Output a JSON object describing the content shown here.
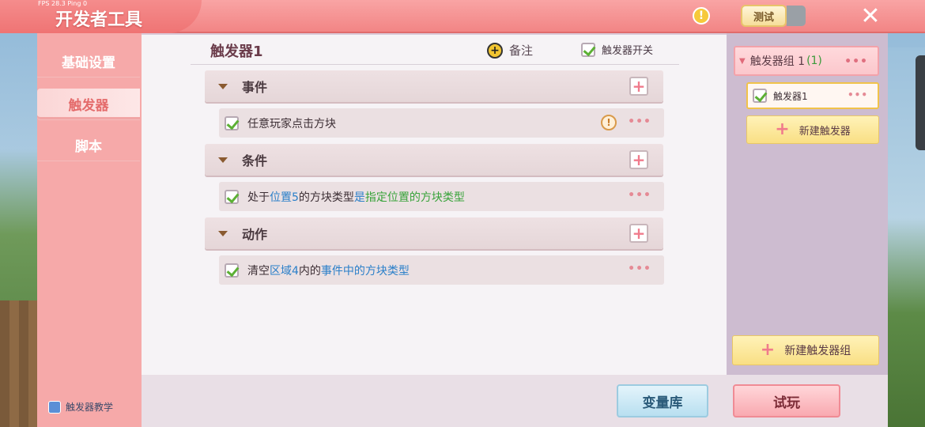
{
  "topbar": {
    "fps": "FPS 28.3  Ping 0",
    "title": "开发者工具",
    "test_label": "测试"
  },
  "sidebar": {
    "items": [
      {
        "label": "基础设置",
        "active": false
      },
      {
        "label": "触发器",
        "active": true
      },
      {
        "label": "脚本",
        "active": false
      }
    ],
    "tutorial_label": "触发器教学"
  },
  "main": {
    "trigger_name": "触发器1",
    "note_label": "备注",
    "switch_label": "触发器开关",
    "sections": [
      {
        "label": "事件",
        "items": [
          {
            "parts": [
              {
                "t": "任意玩家点击方块",
                "c": ""
              }
            ]
          }
        ]
      },
      {
        "label": "条件",
        "items": [
          {
            "parts": [
              {
                "t": "处于",
                "c": ""
              },
              {
                "t": "位置5",
                "c": "blue"
              },
              {
                "t": "的方块类型",
                "c": ""
              },
              {
                "t": "是",
                "c": "blue"
              },
              {
                "t": "指定位置的方块类型",
                "c": "green"
              }
            ]
          }
        ]
      },
      {
        "label": "动作",
        "items": [
          {
            "parts": [
              {
                "t": "清空",
                "c": ""
              },
              {
                "t": "区域4",
                "c": "blue"
              },
              {
                "t": "内的",
                "c": ""
              },
              {
                "t": "事件中的方块类型",
                "c": "blue"
              }
            ]
          }
        ]
      }
    ]
  },
  "right": {
    "group_name": "触发器组 1",
    "group_count": "(1)",
    "trigger_item": "触发器1",
    "new_trigger_label": "新建触发器",
    "new_group_label": "新建触发器组"
  },
  "bottom": {
    "var_label": "变量库",
    "try_label": "试玩"
  },
  "icons": {
    "dots": "•••",
    "plus": "+",
    "close": "✕",
    "warn": "!",
    "chevron": "▼",
    "info": "!"
  }
}
